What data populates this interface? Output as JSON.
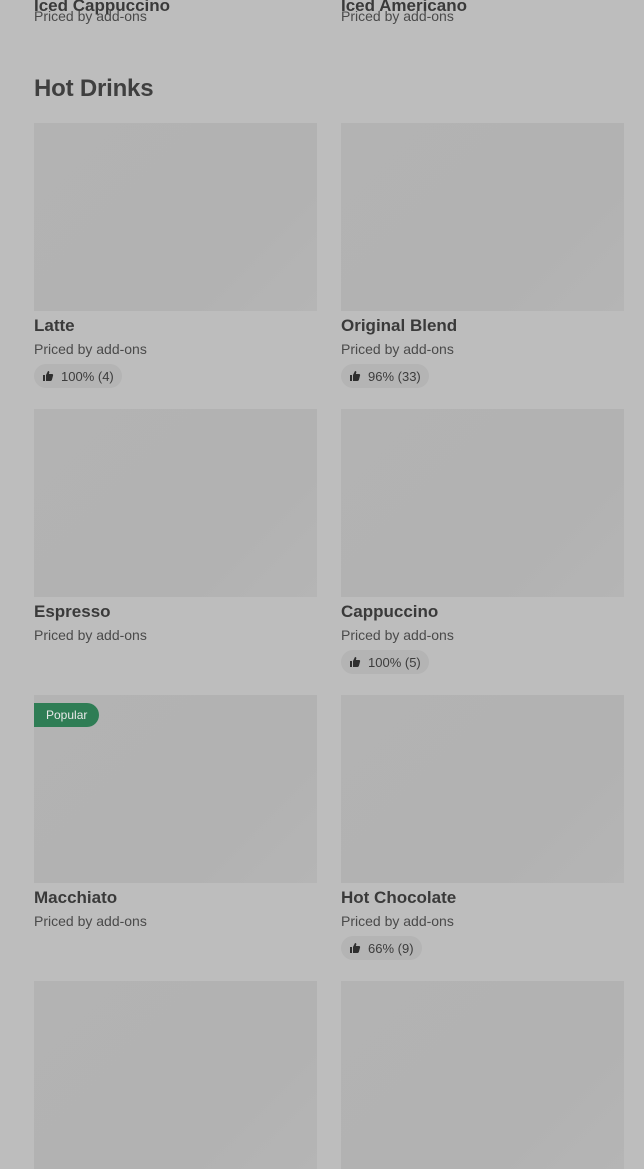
{
  "top_items": {
    "left_title_partial": "Iced Cappuccino",
    "right_title_partial": "Iced Americano",
    "left_price": "Priced by add-ons",
    "right_price": "Priced by add-ons"
  },
  "section": {
    "title": "Hot Drinks"
  },
  "items": [
    {
      "name": "Latte",
      "price": "Priced by add-ons",
      "rating": "100% (4)",
      "badge": ""
    },
    {
      "name": "Original Blend",
      "price": "Priced by add-ons",
      "rating": "96% (33)",
      "badge": ""
    },
    {
      "name": "Espresso",
      "price": "Priced by add-ons",
      "rating": "",
      "badge": ""
    },
    {
      "name": "Cappuccino",
      "price": "Priced by add-ons",
      "rating": "100% (5)",
      "badge": ""
    },
    {
      "name": "Macchiato",
      "price": "Priced by add-ons",
      "rating": "",
      "badge": "Popular"
    },
    {
      "name": "Hot Chocolate",
      "price": "Priced by add-ons",
      "rating": "66% (9)",
      "badge": ""
    }
  ],
  "icons": {
    "rating": "thumbs-up-icon"
  }
}
